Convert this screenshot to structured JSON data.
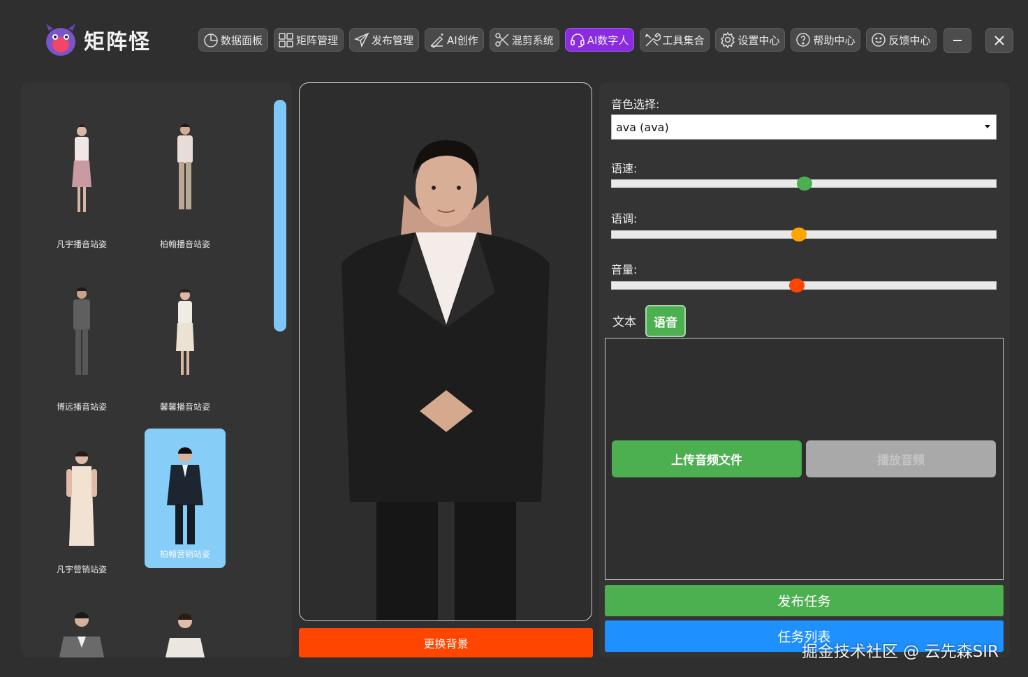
{
  "app": {
    "title": "矩阵怪"
  },
  "nav": [
    {
      "label": "数据面板",
      "icon": "pie-chart-icon"
    },
    {
      "label": "矩阵管理",
      "icon": "grid-icon"
    },
    {
      "label": "发布管理",
      "icon": "send-icon"
    },
    {
      "label": "AI创作",
      "icon": "magic-pen-icon"
    },
    {
      "label": "混剪系统",
      "icon": "scissors-icon"
    },
    {
      "label": "AI数字人",
      "icon": "headset-icon"
    },
    {
      "label": "工具集合",
      "icon": "tools-icon"
    },
    {
      "label": "设置中心",
      "icon": "gear-icon"
    },
    {
      "label": "帮助中心",
      "icon": "help-icon"
    },
    {
      "label": "反馈中心",
      "icon": "smile-icon"
    }
  ],
  "gallery": {
    "avatars": [
      {
        "name": "凡宇播音站姿"
      },
      {
        "name": "柏翰播音站姿"
      },
      {
        "name": "博远播音站姿"
      },
      {
        "name": "馨馨播音站姿"
      },
      {
        "name": "凡宇营销站姿"
      },
      {
        "name": "柏翰营销站姿"
      }
    ]
  },
  "preview": {
    "change_bg_label": "更换背景"
  },
  "settings": {
    "voice_label": "音色选择:",
    "voice_value": "ava (ava)",
    "speed_label": "语速:",
    "pitch_label": "语调:",
    "volume_label": "音量:",
    "speed_value": 0.5,
    "pitch_value": 0.485,
    "volume_value": 0.48,
    "speed_color": "#4caf50",
    "pitch_color": "#ffa500",
    "volume_color": "#ff4500"
  },
  "tabs": {
    "text": "文本",
    "voice": "语音"
  },
  "voice_panel": {
    "upload_label": "上传音频文件",
    "play_label": "播放音频"
  },
  "actions": {
    "publish_label": "发布任务",
    "tasks_label": "任务列表"
  },
  "watermark": "掘金技术社区 @ 云先森SIR",
  "colors": {
    "active_nav": "#8a2be2",
    "selected_card": "#86cdf7"
  }
}
